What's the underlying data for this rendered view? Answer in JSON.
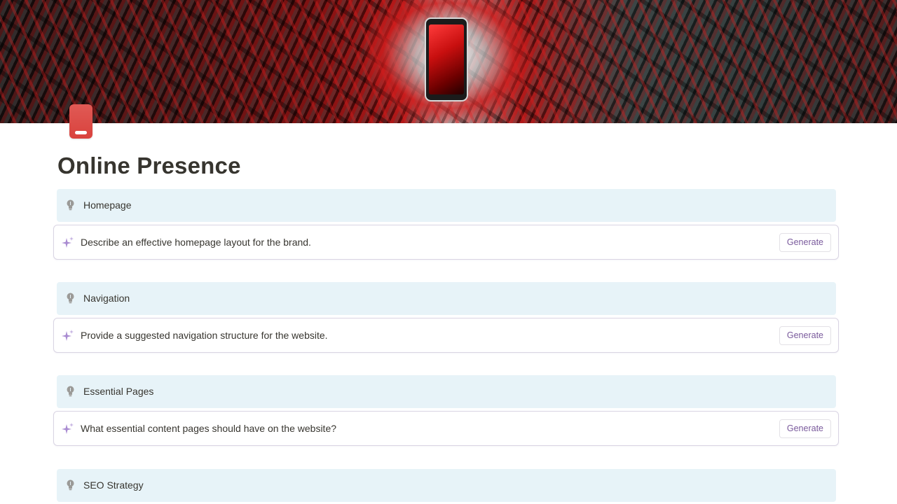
{
  "page": {
    "title": "Online Presence",
    "icon": "phone-icon",
    "accent_color": "#d9423d"
  },
  "colors": {
    "callout_background": "#e7f3f8",
    "generate_text": "#7a5a9c",
    "sparkle": "#a98bd1"
  },
  "sections": [
    {
      "heading": "Homepage",
      "prompt": "Describe an effective homepage layout for the brand.",
      "button_label": "Generate"
    },
    {
      "heading": "Navigation",
      "prompt": "Provide a suggested navigation structure for the website.",
      "button_label": "Generate"
    },
    {
      "heading": "Essential Pages",
      "prompt": "What essential content pages should have on the website?",
      "button_label": "Generate"
    },
    {
      "heading": "SEO Strategy"
    }
  ]
}
